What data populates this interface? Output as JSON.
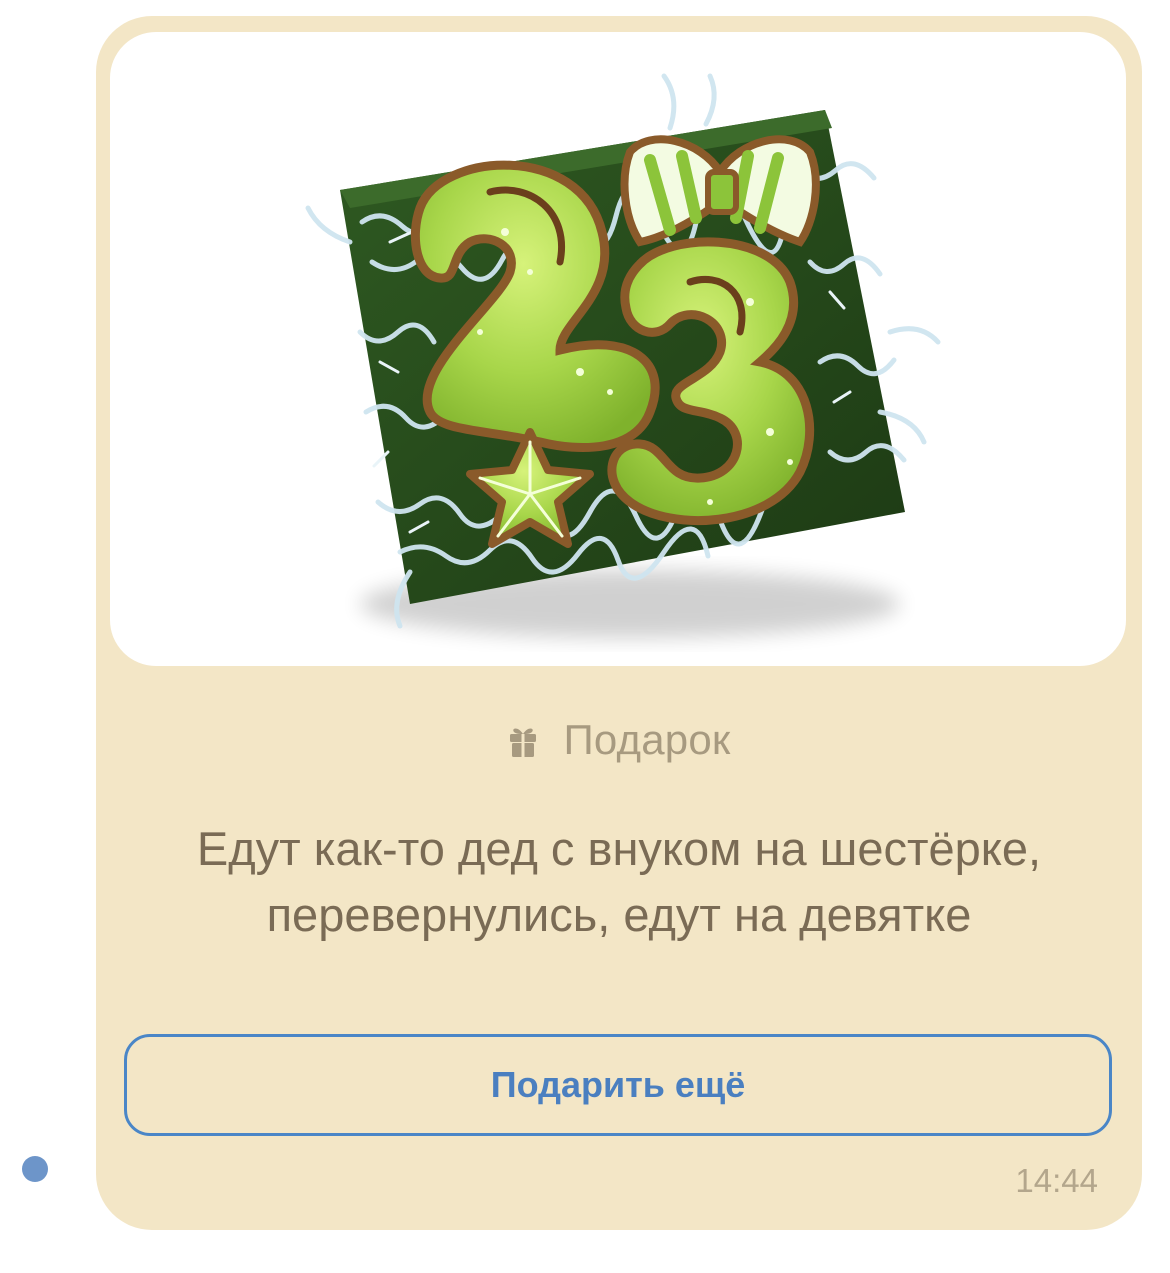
{
  "message": {
    "type_label": "Подарок",
    "text": "Едут как-то дед с внуком на шестёрке, перевернулись, едут на девятке",
    "button_label": "Подарить ещё",
    "time": "14:44",
    "unread": true
  },
  "gift_image": {
    "digits": "23",
    "icons": [
      "gift-box-icon"
    ]
  },
  "colors": {
    "bubble_bg": "#f3e6c6",
    "accent_blue": "#4a86c7",
    "muted_text": "#a79a80",
    "body_text": "#7a6b55",
    "unread_dot": "#6d95c9"
  }
}
